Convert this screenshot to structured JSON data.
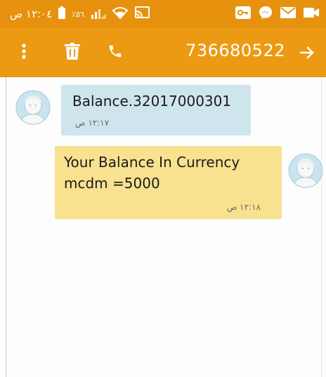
{
  "status_bar": {
    "time": "١٢:٠٤ ص",
    "battery_percent": "٪٥٦",
    "colors": {
      "background": "#e6920f"
    },
    "icons": [
      "battery-icon",
      "signal-icon",
      "wifi-icon",
      "cast-icon",
      "key-icon",
      "messenger-icon",
      "email-icon",
      "video-icon"
    ]
  },
  "app_bar": {
    "phone_number": "736680522",
    "colors": {
      "background": "#ec9a13",
      "foreground": "#ffffff"
    },
    "icons": [
      "more-vert-icon",
      "trash-icon",
      "phone-icon",
      "arrow-right-icon"
    ]
  },
  "messages": [
    {
      "direction": "incoming",
      "text": "Balance.32017000301",
      "time": "١٢:١٧ ص",
      "color": "#cfe5ee"
    },
    {
      "direction": "outgoing",
      "lines": [
        "Your Balance In Currency",
        "mcdm =5000"
      ],
      "time": "١٢:١٨ ص",
      "color": "#f8e18f"
    }
  ]
}
